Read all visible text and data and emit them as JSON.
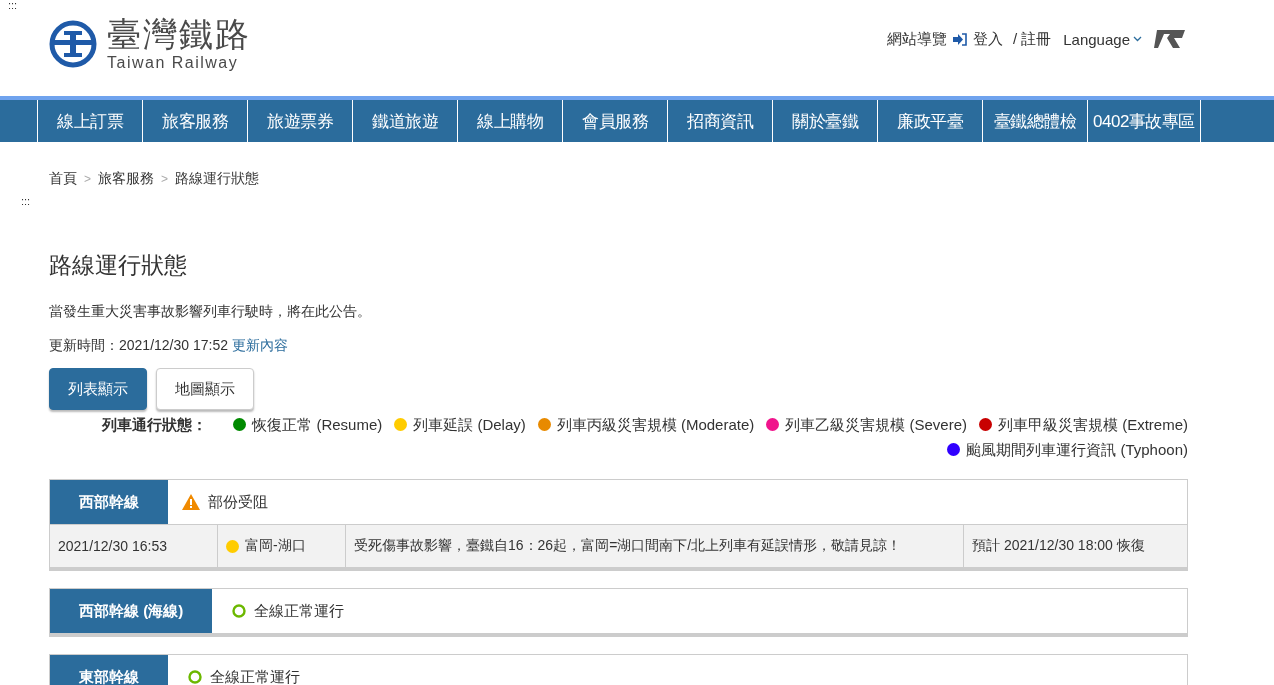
{
  "skip_links": [
    ":::",
    ":::"
  ],
  "logo": {
    "name": "臺灣鐵路",
    "subtitle": "Taiwan Railway"
  },
  "top_links": {
    "sitemap": "網站導覽",
    "login": "登入",
    "register": "/ 註冊",
    "language": "Language"
  },
  "nav": [
    "線上訂票",
    "旅客服務",
    "旅遊票券",
    "鐵道旅遊",
    "線上購物",
    "會員服務",
    "招商資訊",
    "關於臺鐵",
    "廉政平臺",
    "臺鐵總體檢",
    "0402事故專區"
  ],
  "breadcrumb": {
    "separator": ">",
    "items": [
      "首頁",
      "旅客服務",
      "路線運行狀態"
    ]
  },
  "title": "路線運行狀態",
  "intro": "當發生重大災害事故影響列車行駛時，將在此公告。",
  "updated": {
    "label": "更新時間：2021/12/30 17:52",
    "link": "更新內容"
  },
  "view_buttons": [
    {
      "label": "列表顯示",
      "selected": true
    },
    {
      "label": "地圖顯示",
      "selected": false
    }
  ],
  "legend": {
    "label": "列車通行狀態：",
    "items": [
      {
        "text": "恢復正常 (Resume)",
        "color": "#008a00"
      },
      {
        "text": "列車延誤 (Delay)",
        "color": "#ffcc00"
      },
      {
        "text": "列車丙級災害規模 (Moderate)",
        "color": "#e88a00"
      },
      {
        "text": "列車乙級災害規模 (Severe)",
        "color": "#f0148c"
      },
      {
        "text": "列車甲級災害規模 (Extreme)",
        "color": "#c80000"
      },
      {
        "text": "颱風期間列車運行資訊 (Typhoon)",
        "color": "#3000ff"
      }
    ]
  },
  "lines": [
    {
      "name": "西部幹線",
      "kind": "warning",
      "status": "部份受阻",
      "incidents": [
        {
          "time": "2021/12/30 16:53",
          "color": "#ffcc00",
          "section": "富岡-湖口",
          "description": "受死傷事故影響，臺鐵自16：26起，富岡=湖口間南下/北上列車有延誤情形，敬請見諒！",
          "expected": "預計 2021/12/30 18:00 恢復"
        }
      ]
    },
    {
      "name": "西部幹線 (海線)",
      "kind": "normal",
      "status": "全線正常運行"
    },
    {
      "name": "東部幹線",
      "kind": "normal",
      "status": "全線正常運行"
    }
  ]
}
